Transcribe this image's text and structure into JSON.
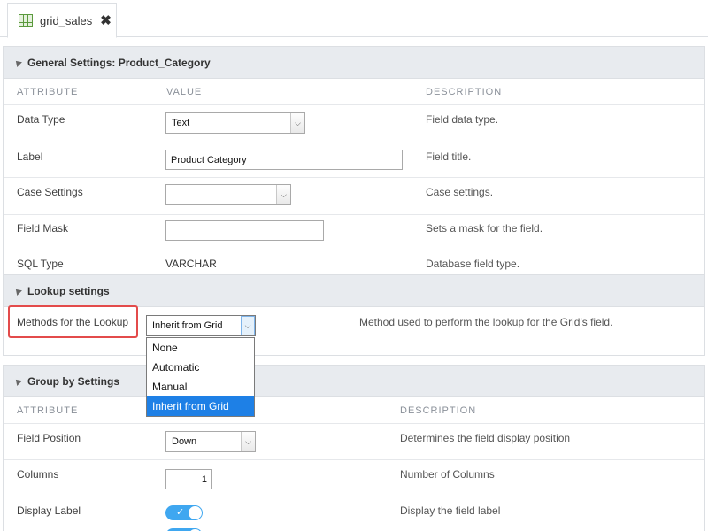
{
  "tab": {
    "icon": "grid-table-icon",
    "label": "grid_sales",
    "close_icon": "close-icon"
  },
  "general": {
    "title": "General Settings: Product_Category",
    "headers": {
      "attribute": "ATTRIBUTE",
      "value": "VALUE",
      "description": "DESCRIPTION"
    },
    "rows": {
      "data_type": {
        "label": "Data Type",
        "value": "Text",
        "description": "Field data type."
      },
      "label": {
        "label": "Label",
        "value": "Product Category",
        "description": "Field title."
      },
      "case_settings": {
        "label": "Case Settings",
        "value": "",
        "description": "Case settings."
      },
      "field_mask": {
        "label": "Field Mask",
        "value": "",
        "description": "Sets a mask for the field."
      },
      "sql_type": {
        "label": "SQL Type",
        "value": "VARCHAR",
        "description": "Database field type."
      }
    }
  },
  "lookup": {
    "title": "Lookup settings",
    "row": {
      "label": "Methods for the Lookup",
      "value": "Inherit from Grid",
      "description": "Method used to perform the lookup for the Grid's field."
    },
    "options": [
      "None",
      "Automatic",
      "Manual",
      "Inherit from Grid"
    ],
    "selected_index": 3
  },
  "groupby": {
    "title": "Group by Settings",
    "headers": {
      "attribute": "ATTRIBUTE",
      "description": "DESCRIPTION"
    },
    "rows": {
      "field_position": {
        "label": "Field Position",
        "value": "Down",
        "description": "Determines the field display position"
      },
      "columns": {
        "label": "Columns",
        "value": "1",
        "description": "Number of Columns"
      },
      "display_label": {
        "label": "Display Label",
        "value": "on",
        "description": "Display the field label"
      }
    }
  },
  "colors": {
    "accent": "#1e80e6",
    "highlight": "#e34b4b",
    "toggle": "#3fa7f0"
  }
}
